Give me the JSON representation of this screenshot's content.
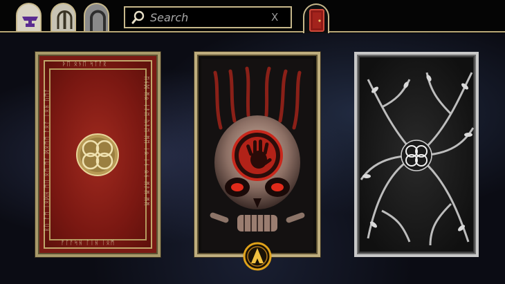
{
  "top_bar": {
    "tabs": [
      {
        "icon": "anvil-icon",
        "color": "#6a2fa0"
      },
      {
        "icon": "pillar-icon",
        "color": "#3a3424"
      },
      {
        "icon": "arch-icon",
        "color": "#3a3a3a"
      }
    ],
    "search": {
      "placeholder": "Search",
      "clear_label": "X"
    },
    "active_tab": {
      "icon": "door-icon",
      "color": "#b0201b"
    }
  },
  "cards": [
    {
      "name": "red-rune-card-back",
      "rune_text_top": "ᚦᛖ ᛟᚾᛖ ᛋᛏᚨᚱ",
      "rune_text_bottom": "ᚠᛚᚨᛋᚺ ᛚᛁᚺ ᛁᛟᛗ",
      "rune_text_left": "ᚱᚢ ᚨᛗ ᛁᛟᛞᚺ ᛗᛖ ᛟᛗ ᛗᚨ ᛞᛟᛗᛗ ᚨᛟᚨ ᛁᛟᚺ ᚢᛗᚨ",
      "rune_text_right": "ᛖᚾᛞ ᛗᛟ ᛁᚨᛖ ᚢᚨᛖ ᛗᛖ ᛁᛟ ᛁᚾ ᛟᚾ ᛗᚨᛗ ᛗᛗ",
      "emblem": "celtic-knot-emblem"
    },
    {
      "name": "skull-hand-card-back",
      "emblem": "dark-brotherhood-hand-emblem",
      "selected": true
    },
    {
      "name": "silver-branches-card-back",
      "emblem": "celtic-knot-emblem"
    }
  ],
  "selection": {
    "icon": "chevron-up-icon",
    "color": "#e0a21a"
  }
}
